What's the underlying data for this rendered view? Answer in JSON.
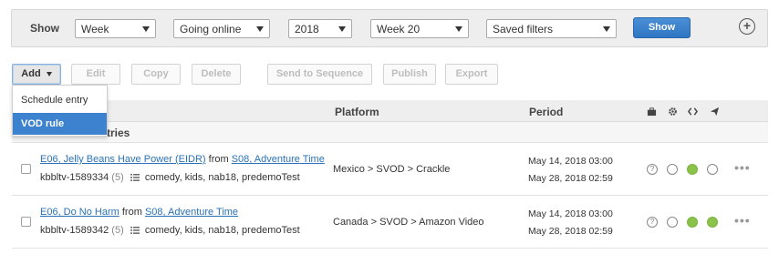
{
  "filters": {
    "show_label": "Show",
    "period_type": "Week",
    "status": "Going online",
    "year": "2018",
    "week": "Week 20",
    "saved_filters": "Saved filters",
    "show_button": "Show",
    "add_symbol": "+"
  },
  "toolbar": {
    "add": "Add",
    "edit": "Edit",
    "copy": "Copy",
    "delete": "Delete",
    "send_to_sequence": "Send to Sequence",
    "publish": "Publish",
    "export": "Export"
  },
  "add_menu": {
    "items": [
      "Schedule entry",
      "VOD rule"
    ],
    "active": "VOD rule"
  },
  "table": {
    "headers": {
      "platform": "Platform",
      "period": "Period"
    },
    "header_icons": [
      "briefcase-icon",
      "gear-icon",
      "code-icon",
      "send-icon"
    ],
    "group_label": "tries",
    "rows": [
      {
        "episode": "E06, Jelly Beans Have Power (EIDR)",
        "from_text": "from",
        "season": "S08, Adventure Time",
        "id": "kbbltv-1589334",
        "count": "(5)",
        "tags": "comedy, kids, nab18, predemoTest",
        "platform": "Mexico > SVOD > Crackle",
        "period_start": "May 14, 2018 03:00",
        "period_end": "May 28, 2018 02:59",
        "status_dots": [
          "empty",
          "green",
          "empty"
        ],
        "more": "•••"
      },
      {
        "episode": "E06, Do No Harm",
        "from_text": "from",
        "season": "S08, Adventure Time",
        "id": "kbbltv-1589342",
        "count": "(5)",
        "tags": "comedy, kids, nab18, predemoTest",
        "platform": "Canada > SVOD > Amazon Video",
        "period_start": "May 14, 2018 03:00",
        "period_end": "May 28, 2018 02:59",
        "status_dots": [
          "empty",
          "green",
          "green"
        ],
        "more": "•••"
      }
    ]
  },
  "colors": {
    "accent": "#3c82cf",
    "status_green": "#8bc34a",
    "link": "#2a72b5"
  }
}
